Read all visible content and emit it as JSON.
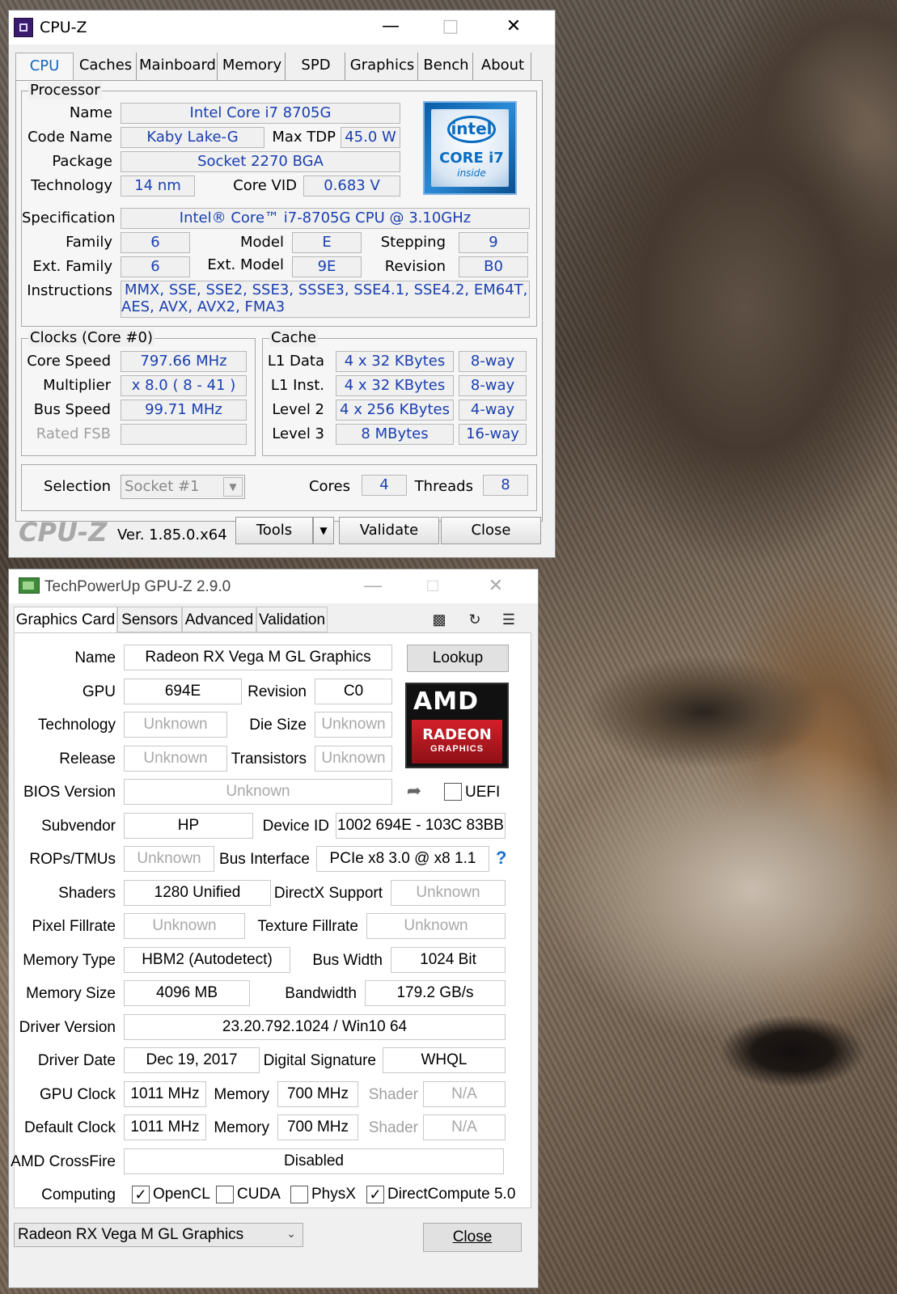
{
  "cpuz": {
    "title": "CPU-Z",
    "tabs": [
      "CPU",
      "Caches",
      "Mainboard",
      "Memory",
      "SPD",
      "Graphics",
      "Bench",
      "About"
    ],
    "processor": {
      "group_label": "Processor",
      "name_label": "Name",
      "name": "Intel Core i7 8705G",
      "codename_label": "Code Name",
      "codename": "Kaby Lake-G",
      "maxtdp_label": "Max TDP",
      "maxtdp": "45.0 W",
      "package_label": "Package",
      "package": "Socket 2270 BGA",
      "technology_label": "Technology",
      "technology": "14 nm",
      "corevid_label": "Core VID",
      "corevid": "0.683 V",
      "spec_label": "Specification",
      "spec": "Intel® Core™ i7-8705G CPU @ 3.10GHz",
      "family_label": "Family",
      "family": "6",
      "model_label": "Model",
      "model": "E",
      "stepping_label": "Stepping",
      "stepping": "9",
      "extfamily_label": "Ext. Family",
      "extfamily": "6",
      "extmodel_label": "Ext. Model",
      "extmodel": "9E",
      "revision_label": "Revision",
      "revision": "B0",
      "instructions_label": "Instructions",
      "instructions_line1": "MMX, SSE, SSE2, SSE3, SSSE3, SSE4.1, SSE4.2, EM64T, VT-x,",
      "instructions_line2": "AES, AVX, AVX2, FMA3"
    },
    "logo": {
      "brand": "intel",
      "line1": "CORE i7",
      "line2": "inside"
    },
    "clocks": {
      "group_label": "Clocks (Core #0)",
      "corespeed_label": "Core Speed",
      "corespeed": "797.66 MHz",
      "multiplier_label": "Multiplier",
      "multiplier": "x 8.0 ( 8 - 41 )",
      "busspeed_label": "Bus Speed",
      "busspeed": "99.71 MHz",
      "ratedfsb_label": "Rated FSB",
      "ratedfsb": ""
    },
    "cache": {
      "group_label": "Cache",
      "rows": [
        {
          "label": "L1 Data",
          "size": "4 x 32 KBytes",
          "way": "8-way"
        },
        {
          "label": "L1 Inst.",
          "size": "4 x 32 KBytes",
          "way": "8-way"
        },
        {
          "label": "Level 2",
          "size": "4 x 256 KBytes",
          "way": "4-way"
        },
        {
          "label": "Level 3",
          "size": "8 MBytes",
          "way": "16-way"
        }
      ]
    },
    "selection_label": "Selection",
    "selection": "Socket #1",
    "cores_label": "Cores",
    "cores": "4",
    "threads_label": "Threads",
    "threads": "8",
    "brand_text": "CPU-Z",
    "version": "Ver. 1.85.0.x64",
    "tools_label": "Tools",
    "validate_label": "Validate",
    "close_label": "Close"
  },
  "gpuz": {
    "title": "TechPowerUp GPU-Z 2.9.0",
    "tabs": [
      "Graphics Card",
      "Sensors",
      "Advanced",
      "Validation"
    ],
    "name_label": "Name",
    "name": "Radeon RX Vega M GL Graphics",
    "lookup_label": "Lookup",
    "gpu_label": "GPU",
    "gpu": "694E",
    "revision_label": "Revision",
    "revision": "C0",
    "technology_label": "Technology",
    "technology": "Unknown",
    "diesize_label": "Die Size",
    "diesize": "Unknown",
    "release_label": "Release",
    "release": "Unknown",
    "transistors_label": "Transistors",
    "transistors": "Unknown",
    "bios_label": "BIOS Version",
    "bios": "Unknown",
    "uefi_label": "UEFI",
    "subvendor_label": "Subvendor",
    "subvendor": "HP",
    "deviceid_label": "Device ID",
    "deviceid": "1002 694E - 103C 83BB",
    "rops_label": "ROPs/TMUs",
    "rops": "Unknown",
    "businterface_label": "Bus Interface",
    "businterface": "PCIe x8 3.0 @ x8 1.1",
    "help_glyph": "?",
    "shaders_label": "Shaders",
    "shaders": "1280 Unified",
    "directx_label": "DirectX Support",
    "directx": "Unknown",
    "pixelfill_label": "Pixel Fillrate",
    "pixelfill": "Unknown",
    "texturefill_label": "Texture Fillrate",
    "texturefill": "Unknown",
    "memtype_label": "Memory Type",
    "memtype": "HBM2 (Autodetect)",
    "buswidth_label": "Bus Width",
    "buswidth": "1024 Bit",
    "memsize_label": "Memory Size",
    "memsize": "4096 MB",
    "bandwidth_label": "Bandwidth",
    "bandwidth": "179.2 GB/s",
    "driverversion_label": "Driver Version",
    "driverversion": "23.20.792.1024 / Win10 64",
    "driverdate_label": "Driver Date",
    "driverdate": "Dec 19, 2017",
    "digsig_label": "Digital Signature",
    "digsig": "WHQL",
    "gpuclock_label": "GPU Clock",
    "gpuclock": "1011 MHz",
    "memory_label": "Memory",
    "memclock": "700 MHz",
    "shader_label": "Shader",
    "shaderclock": "N/A",
    "defclock_label": "Default Clock",
    "defclock": "1011 MHz",
    "defmemclock": "700 MHz",
    "defshaderclock": "N/A",
    "crossfire_label": "AMD CrossFire",
    "crossfire": "Disabled",
    "computing_label": "Computing",
    "opencl_label": "OpenCL",
    "cuda_label": "CUDA",
    "physx_label": "PhysX",
    "directcompute_label": "DirectCompute 5.0",
    "check_mark": "✓",
    "logo": {
      "brand": "AMD",
      "line1": "RADEON",
      "line2": "GRAPHICS"
    },
    "selected_card": "Radeon RX Vega M GL Graphics",
    "close_label": "Close"
  }
}
